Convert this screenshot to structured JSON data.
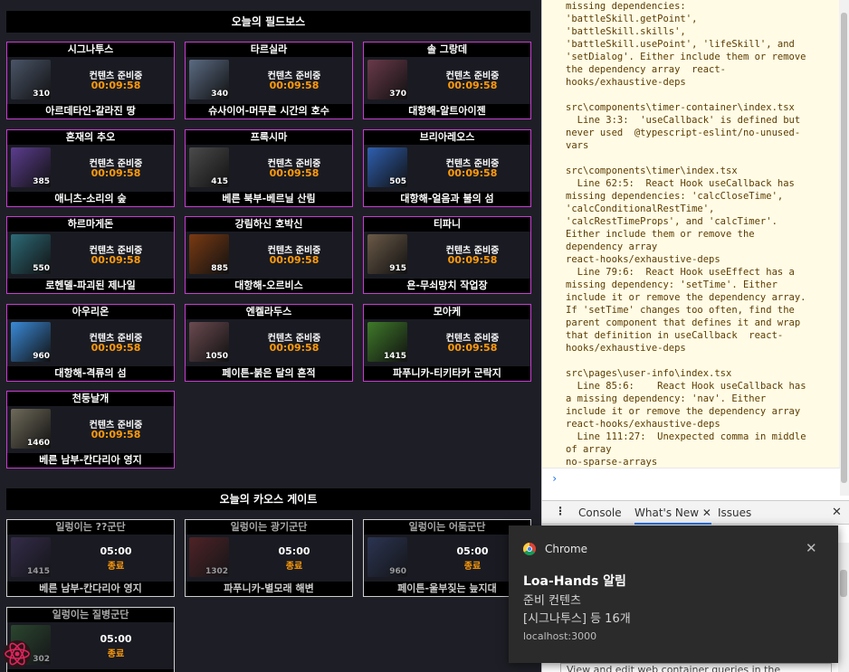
{
  "field_boss_title": "오늘의 필드보스",
  "chaos_gate_title": "오늘의 카오스 게이트",
  "status_text": "컨텐츠 준비중",
  "timer": "00:09:58",
  "field_bosses": [
    {
      "name": "시그나투스",
      "level": "310",
      "location": "아르데타인-갈라진 땅"
    },
    {
      "name": "타르실라",
      "level": "340",
      "location": "슈사이어-머무른 시간의 호수"
    },
    {
      "name": "솔 그랑데",
      "level": "370",
      "location": "대항해-알트아이젠"
    },
    {
      "name": "혼재의 추오",
      "level": "385",
      "location": "애니츠-소리의 숲"
    },
    {
      "name": "프록시마",
      "level": "415",
      "location": "베른 북부-베르닐 산림"
    },
    {
      "name": "브리아레오스",
      "level": "505",
      "location": "대항해-얼음과 불의 섬"
    },
    {
      "name": "하르마게돈",
      "level": "550",
      "location": "로헨델-파괴된 제나일"
    },
    {
      "name": "강림하신 호박신",
      "level": "885",
      "location": "대항해-오르비스"
    },
    {
      "name": "티파니",
      "level": "915",
      "location": "욘-무쇠망치 작업장"
    },
    {
      "name": "아우리온",
      "level": "960",
      "location": "대항해-격류의 섬"
    },
    {
      "name": "엔켈라두스",
      "level": "1050",
      "location": "페이튼-붉은 달의 흔적"
    },
    {
      "name": "모아케",
      "level": "1415",
      "location": "파푸니카-티키타카 군락지"
    },
    {
      "name": "천둥날개",
      "level": "1460",
      "location": "베른 남부-칸다리아 영지"
    }
  ],
  "chaos_gates": [
    {
      "name": "일렁이는 ??군단",
      "timer": "05:00",
      "status": "종료",
      "level": "1415",
      "location": "베른 남부-칸다리아 영지"
    },
    {
      "name": "일렁이는 광기군단",
      "timer": "05:00",
      "status": "종료",
      "level": "1302",
      "location": "파푸니카-별모래 해변"
    },
    {
      "name": "일렁이는 어둠군단",
      "timer": "05:00",
      "status": "종료",
      "level": "960",
      "location": "페이튼-울부짖는 늪지대"
    },
    {
      "name": "일렁이는 질병군단",
      "timer": "05:00",
      "status": "종료",
      "level": "302",
      "location": ""
    }
  ],
  "console_text": "missing dependencies:\n'battleSkill.getPoint',\n'battleSkill.skills',\n'battleSkill.usePoint', 'lifeSkill', and\n'setDialog'. Either include them or remove\nthe dependency array  react-\nhooks/exhaustive-deps\n\nsrc\\components\\timer-container\\index.tsx\n  Line 3:3:  'useCallback' is defined but\nnever used  @typescript-eslint/no-unused-\nvars\n\nsrc\\components\\timer\\index.tsx\n  Line 62:5:  React Hook useCallback has\nmissing dependencies: 'calcCloseTime',\n'calcConditionalRestTime',\n'calcRestTimeProps', and 'calcTimer'.\nEither include them or remove the\ndependency array\nreact-hooks/exhaustive-deps\n  Line 79:6:  React Hook useEffect has a\nmissing dependency: 'setTime'. Either\ninclude it or remove the dependency array.\nIf 'setTime' changes too often, find the\nparent component that defines it and wrap\nthat definition in useCallback  react-\nhooks/exhaustive-deps\n\nsrc\\pages\\user-info\\index.tsx\n  Line 85:6:    React Hook useCallback has\na missing dependency: 'nav'. Either\ninclude it or remove the dependency array\nreact-hooks/exhaustive-deps\n  Line 111:27:  Unexpected comma in middle\nof array\nno-sparse-arrays",
  "prompt_symbol": "›",
  "drawer": {
    "menu": "⋮",
    "tabs": [
      "Console",
      "What's New",
      "Issues"
    ],
    "active_close": "✕",
    "close": "✕",
    "footer_text": "View and edit web container queries in the"
  },
  "notification": {
    "app": "Chrome",
    "close": "✕",
    "title": "Loa-Hands 알림",
    "line1": "준비 컨텐츠",
    "line2": "[시그나투스] 등 16개",
    "source": "localhost:3000"
  },
  "thumb_colors": [
    "#4a5568",
    "#5b6b83",
    "#6a3a4a",
    "#5c3d8f",
    "#4b4b4b",
    "#2f5fb0",
    "#2d6b78",
    "#7a3a12",
    "#6b5a48",
    "#3a8ad8",
    "#6a4a50",
    "#3f7a2a",
    "#6f6a5a"
  ],
  "gate_colors": [
    "#4a3a6a",
    "#7a2a2a",
    "#3a4a7a",
    "#3a6a3a"
  ]
}
